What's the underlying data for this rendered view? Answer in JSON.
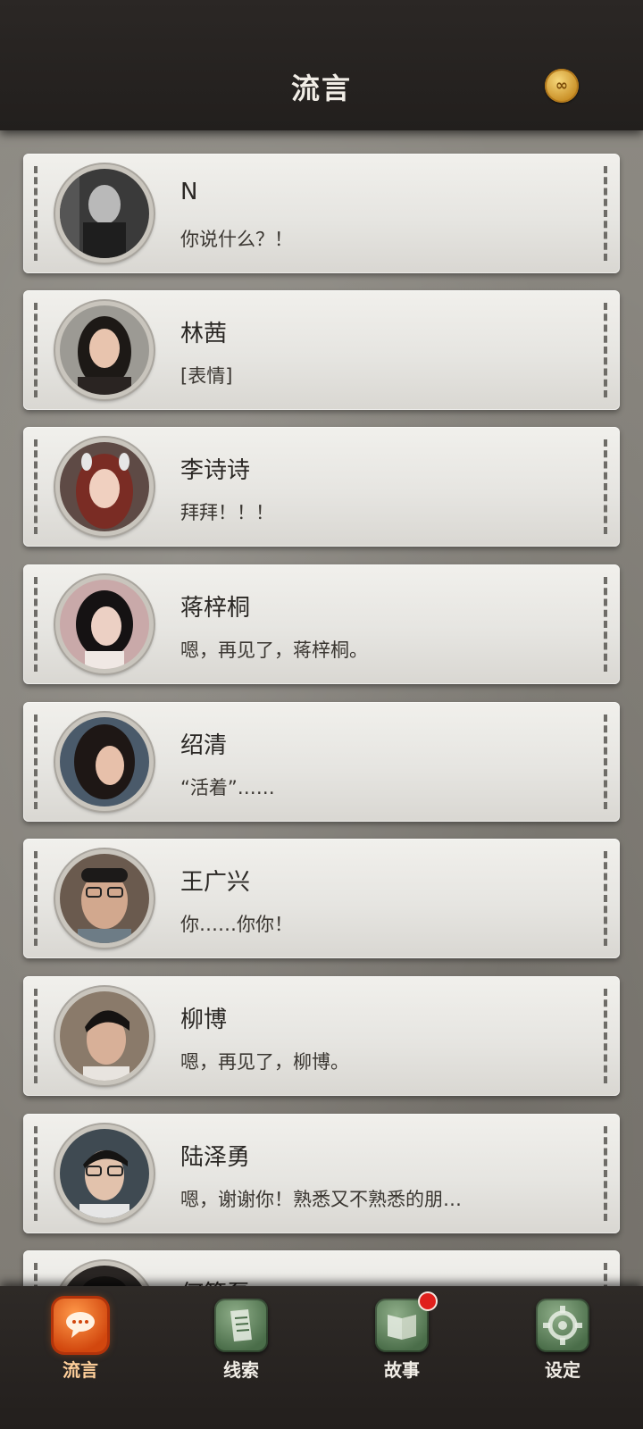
{
  "header": {
    "title": "流言",
    "coin_icon": "infinity-coin-icon",
    "coin_symbol": "∞"
  },
  "contacts": [
    {
      "name": "N",
      "message": "你说什么？！"
    },
    {
      "name": "林茜",
      "message": "[表情]"
    },
    {
      "name": "李诗诗",
      "message": "拜拜！！！"
    },
    {
      "name": "蒋梓桐",
      "message": "嗯，再见了，蒋梓桐。"
    },
    {
      "name": "绍清",
      "message": "“活着”……"
    },
    {
      "name": "王广兴",
      "message": "你……你你！"
    },
    {
      "name": "柳博",
      "message": "嗯，再见了，柳博。"
    },
    {
      "name": "陆泽勇",
      "message": "嗯，谢谢你！熟悉又不熟悉的朋…"
    },
    {
      "name": "何筱磊",
      "message": ""
    }
  ],
  "tabs": [
    {
      "label": "流言",
      "icon": "chat-bubble-icon",
      "active": true
    },
    {
      "label": "线索",
      "icon": "document-icon",
      "active": false
    },
    {
      "label": "故事",
      "icon": "book-icon",
      "active": false,
      "badge": true
    },
    {
      "label": "设定",
      "icon": "gear-icon",
      "active": false
    }
  ]
}
